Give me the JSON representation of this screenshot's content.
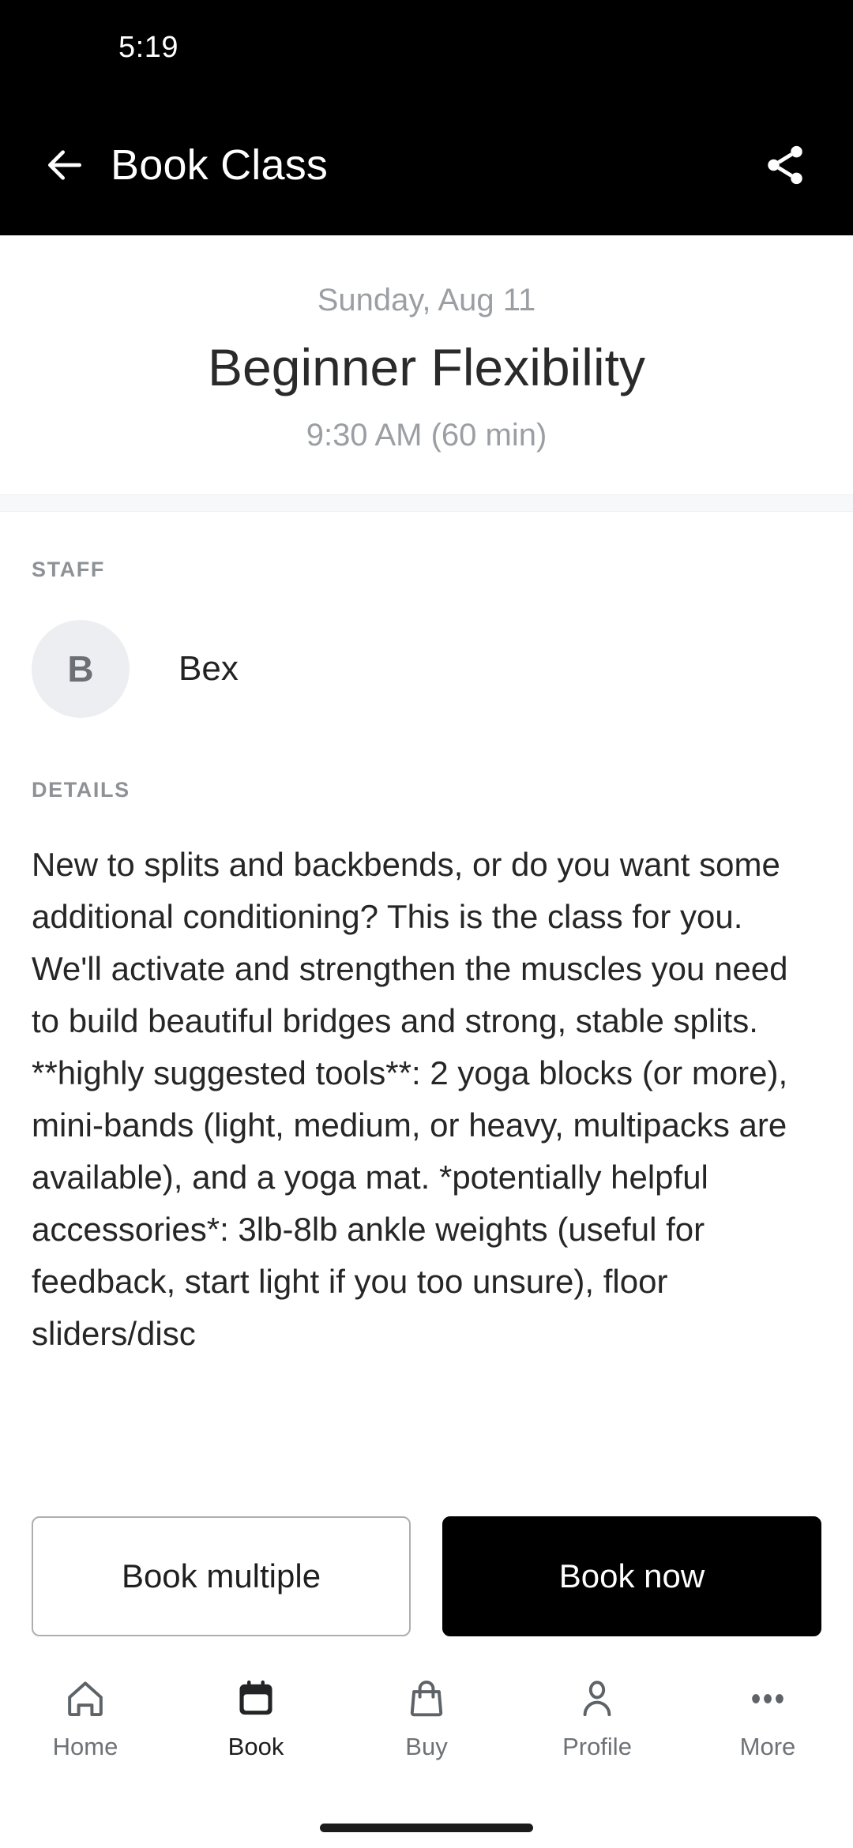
{
  "status_bar": {
    "time": "5:19"
  },
  "app_bar": {
    "back_icon": "arrow-left-icon",
    "title": "Book Class",
    "share_icon": "share-icon"
  },
  "class_header": {
    "date": "Sunday, Aug 11",
    "name": "Beginner Flexibility",
    "time": "9:30 AM (60 min)"
  },
  "staff_section": {
    "label": "STAFF",
    "avatar_initial": "B",
    "name": "Bex"
  },
  "details_section": {
    "label": "DETAILS",
    "body": "New to splits and backbends, or do you want some additional conditioning? This is the class for you. We'll activate and strengthen the muscles you need to build beautiful bridges and strong, stable splits.   **highly suggested tools**: 2 yoga blocks (or more), mini-bands (light, medium, or heavy, multipacks are available), and a yoga mat. *potentially helpful accessories*: 3lb-8lb ankle weights (useful for feedback, start light if you too unsure), floor sliders/disc"
  },
  "action_bar": {
    "secondary_label": "Book multiple",
    "primary_label": "Book now"
  },
  "bottom_nav": {
    "items": [
      {
        "label": "Home",
        "icon": "home-icon",
        "active": false
      },
      {
        "label": "Book",
        "icon": "calendar-icon",
        "active": true
      },
      {
        "label": "Buy",
        "icon": "bag-icon",
        "active": false
      },
      {
        "label": "Profile",
        "icon": "person-icon",
        "active": false
      },
      {
        "label": "More",
        "icon": "dots-icon",
        "active": false
      }
    ]
  },
  "colors": {
    "app_bar_bg": "#000000",
    "primary_button_bg": "#000000",
    "muted_text": "#9b9fa4",
    "section_band": "#f6f8fa",
    "avatar_bg": "#eceef1"
  }
}
